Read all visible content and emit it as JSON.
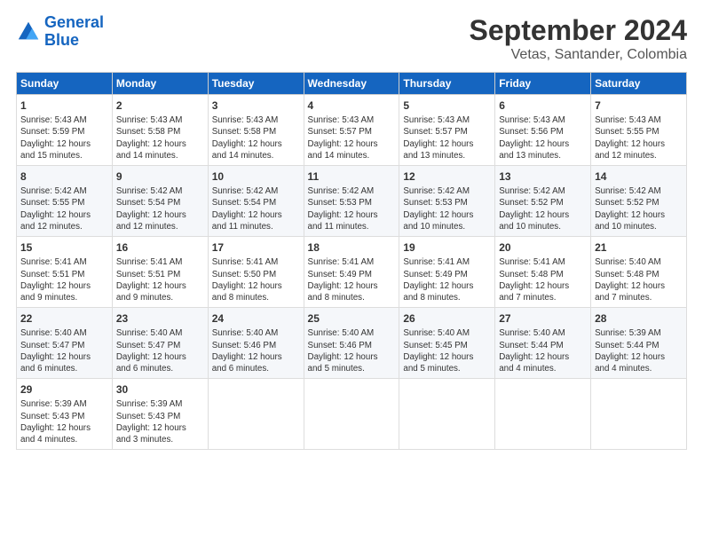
{
  "logo": {
    "line1": "General",
    "line2": "Blue"
  },
  "title": "September 2024",
  "subtitle": "Vetas, Santander, Colombia",
  "headers": [
    "Sunday",
    "Monday",
    "Tuesday",
    "Wednesday",
    "Thursday",
    "Friday",
    "Saturday"
  ],
  "weeks": [
    [
      {
        "day": "1",
        "text": "Sunrise: 5:43 AM\nSunset: 5:59 PM\nDaylight: 12 hours\nand 15 minutes."
      },
      {
        "day": "2",
        "text": "Sunrise: 5:43 AM\nSunset: 5:58 PM\nDaylight: 12 hours\nand 14 minutes."
      },
      {
        "day": "3",
        "text": "Sunrise: 5:43 AM\nSunset: 5:58 PM\nDaylight: 12 hours\nand 14 minutes."
      },
      {
        "day": "4",
        "text": "Sunrise: 5:43 AM\nSunset: 5:57 PM\nDaylight: 12 hours\nand 14 minutes."
      },
      {
        "day": "5",
        "text": "Sunrise: 5:43 AM\nSunset: 5:57 PM\nDaylight: 12 hours\nand 13 minutes."
      },
      {
        "day": "6",
        "text": "Sunrise: 5:43 AM\nSunset: 5:56 PM\nDaylight: 12 hours\nand 13 minutes."
      },
      {
        "day": "7",
        "text": "Sunrise: 5:43 AM\nSunset: 5:55 PM\nDaylight: 12 hours\nand 12 minutes."
      }
    ],
    [
      {
        "day": "8",
        "text": "Sunrise: 5:42 AM\nSunset: 5:55 PM\nDaylight: 12 hours\nand 12 minutes."
      },
      {
        "day": "9",
        "text": "Sunrise: 5:42 AM\nSunset: 5:54 PM\nDaylight: 12 hours\nand 12 minutes."
      },
      {
        "day": "10",
        "text": "Sunrise: 5:42 AM\nSunset: 5:54 PM\nDaylight: 12 hours\nand 11 minutes."
      },
      {
        "day": "11",
        "text": "Sunrise: 5:42 AM\nSunset: 5:53 PM\nDaylight: 12 hours\nand 11 minutes."
      },
      {
        "day": "12",
        "text": "Sunrise: 5:42 AM\nSunset: 5:53 PM\nDaylight: 12 hours\nand 10 minutes."
      },
      {
        "day": "13",
        "text": "Sunrise: 5:42 AM\nSunset: 5:52 PM\nDaylight: 12 hours\nand 10 minutes."
      },
      {
        "day": "14",
        "text": "Sunrise: 5:42 AM\nSunset: 5:52 PM\nDaylight: 12 hours\nand 10 minutes."
      }
    ],
    [
      {
        "day": "15",
        "text": "Sunrise: 5:41 AM\nSunset: 5:51 PM\nDaylight: 12 hours\nand 9 minutes."
      },
      {
        "day": "16",
        "text": "Sunrise: 5:41 AM\nSunset: 5:51 PM\nDaylight: 12 hours\nand 9 minutes."
      },
      {
        "day": "17",
        "text": "Sunrise: 5:41 AM\nSunset: 5:50 PM\nDaylight: 12 hours\nand 8 minutes."
      },
      {
        "day": "18",
        "text": "Sunrise: 5:41 AM\nSunset: 5:49 PM\nDaylight: 12 hours\nand 8 minutes."
      },
      {
        "day": "19",
        "text": "Sunrise: 5:41 AM\nSunset: 5:49 PM\nDaylight: 12 hours\nand 8 minutes."
      },
      {
        "day": "20",
        "text": "Sunrise: 5:41 AM\nSunset: 5:48 PM\nDaylight: 12 hours\nand 7 minutes."
      },
      {
        "day": "21",
        "text": "Sunrise: 5:40 AM\nSunset: 5:48 PM\nDaylight: 12 hours\nand 7 minutes."
      }
    ],
    [
      {
        "day": "22",
        "text": "Sunrise: 5:40 AM\nSunset: 5:47 PM\nDaylight: 12 hours\nand 6 minutes."
      },
      {
        "day": "23",
        "text": "Sunrise: 5:40 AM\nSunset: 5:47 PM\nDaylight: 12 hours\nand 6 minutes."
      },
      {
        "day": "24",
        "text": "Sunrise: 5:40 AM\nSunset: 5:46 PM\nDaylight: 12 hours\nand 6 minutes."
      },
      {
        "day": "25",
        "text": "Sunrise: 5:40 AM\nSunset: 5:46 PM\nDaylight: 12 hours\nand 5 minutes."
      },
      {
        "day": "26",
        "text": "Sunrise: 5:40 AM\nSunset: 5:45 PM\nDaylight: 12 hours\nand 5 minutes."
      },
      {
        "day": "27",
        "text": "Sunrise: 5:40 AM\nSunset: 5:44 PM\nDaylight: 12 hours\nand 4 minutes."
      },
      {
        "day": "28",
        "text": "Sunrise: 5:39 AM\nSunset: 5:44 PM\nDaylight: 12 hours\nand 4 minutes."
      }
    ],
    [
      {
        "day": "29",
        "text": "Sunrise: 5:39 AM\nSunset: 5:43 PM\nDaylight: 12 hours\nand 4 minutes."
      },
      {
        "day": "30",
        "text": "Sunrise: 5:39 AM\nSunset: 5:43 PM\nDaylight: 12 hours\nand 3 minutes."
      },
      {
        "day": "",
        "text": ""
      },
      {
        "day": "",
        "text": ""
      },
      {
        "day": "",
        "text": ""
      },
      {
        "day": "",
        "text": ""
      },
      {
        "day": "",
        "text": ""
      }
    ]
  ]
}
